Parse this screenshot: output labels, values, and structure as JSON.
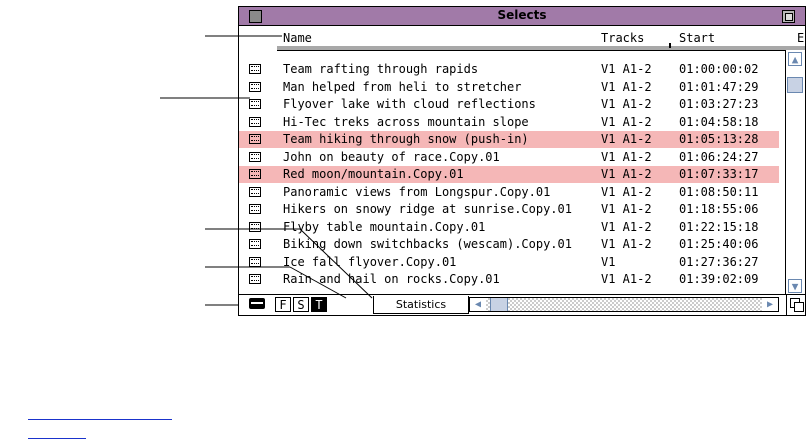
{
  "window": {
    "title": "Selects"
  },
  "columns": {
    "name": "Name",
    "tracks": "Tracks",
    "start": "Start",
    "overflow": "E"
  },
  "rows": [
    {
      "name": "Team rafting through rapids",
      "tracks": "V1 A1-2",
      "start": "01:00:00:02",
      "selected": false
    },
    {
      "name": "Man helped from heli to stretcher",
      "tracks": "V1 A1-2",
      "start": "01:01:47:29",
      "selected": false
    },
    {
      "name": "Flyover lake with cloud reflections",
      "tracks": "V1 A1-2",
      "start": "01:03:27:23",
      "selected": false
    },
    {
      "name": "Hi-Tec treks across mountain slope",
      "tracks": "V1 A1-2",
      "start": "01:04:58:18",
      "selected": false
    },
    {
      "name": "Team hiking through snow (push-in)",
      "tracks": "V1 A1-2",
      "start": "01:05:13:28",
      "selected": true
    },
    {
      "name": "John on beauty of race.Copy.01",
      "tracks": "V1 A1-2",
      "start": "01:06:24:27",
      "selected": false
    },
    {
      "name": "Red moon/mountain.Copy.01",
      "tracks": "V1 A1-2",
      "start": "01:07:33:17",
      "selected": true
    },
    {
      "name": "Panoramic views from Longspur.Copy.01",
      "tracks": "V1 A1-2",
      "start": "01:08:50:11",
      "selected": false
    },
    {
      "name": "Hikers on snowy ridge at sunrise.Copy.01",
      "tracks": "V1 A1-2",
      "start": "01:18:55:06",
      "selected": false
    },
    {
      "name": "Flyby table mountain.Copy.01",
      "tracks": "V1 A1-2",
      "start": "01:22:15:18",
      "selected": false
    },
    {
      "name": "Biking down switchbacks (wescam).Copy.01",
      "tracks": "V1 A1-2",
      "start": "01:25:40:06",
      "selected": false
    },
    {
      "name": "Ice fall flyover.Copy.01",
      "tracks": "V1",
      "start": "01:27:36:27",
      "selected": false
    },
    {
      "name": "Rain and hail on rocks.Copy.01",
      "tracks": "V1 A1-2",
      "start": "01:39:02:09",
      "selected": false
    }
  ],
  "bottom_bar": {
    "view_f": "F",
    "view_s": "S",
    "view_t": "T",
    "statistics_tab": "Statistics"
  },
  "colors": {
    "title_bar": "#a17aa8",
    "selection": "#f5b7b7",
    "scroll_accent": "#6a88b0",
    "link": "#1a33cc"
  },
  "icons": [
    "clip-icon",
    "bin-view-icon",
    "scroll-up-icon",
    "scroll-down-icon",
    "scroll-left-icon",
    "scroll-right-icon",
    "grow-box-icon"
  ]
}
